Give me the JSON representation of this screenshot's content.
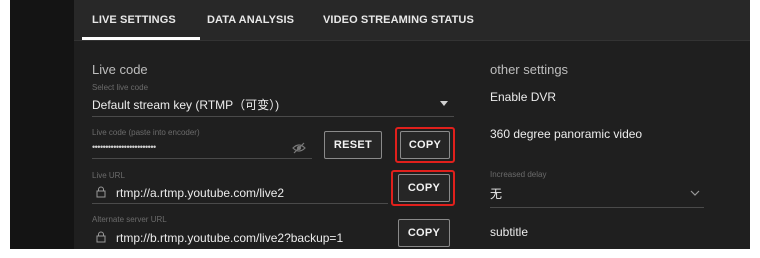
{
  "tabs": [
    {
      "label": "LIVE SETTINGS",
      "active": true
    },
    {
      "label": "DATA ANALYSIS",
      "active": false
    },
    {
      "label": "VIDEO STREAMING STATUS",
      "active": false
    }
  ],
  "live_code": {
    "title": "Live code",
    "select_label": "Select live code",
    "select_value": "Default stream key (RTMP（可变）)",
    "key_label": "Live code (paste into encoder)",
    "key_value": "••••••••••••••••••••••••",
    "reset_label": "RESET",
    "copy_key_label": "COPY"
  },
  "live_url": {
    "label": "Live URL",
    "value": "rtmp://a.rtmp.youtube.com/live2",
    "copy_label": "COPY"
  },
  "backup_url": {
    "label": "Alternate server URL",
    "value": "rtmp://b.rtmp.youtube.com/live2?backup=1",
    "copy_label": "COPY"
  },
  "other_settings": {
    "title": "other settings",
    "enable_dvr": "Enable DVR",
    "panoramic": "360 degree panoramic video",
    "delay_label": "Increased delay",
    "delay_value": "无",
    "subtitle": "subtitle"
  },
  "colors": {
    "highlight": "#e0201c",
    "panel_bg": "#1f1f1f",
    "tab_bar_bg": "#282828"
  },
  "icons": {
    "eye_off": "eye-off-icon",
    "lock": "lock-icon",
    "dropdown": "chevron-down-icon"
  }
}
